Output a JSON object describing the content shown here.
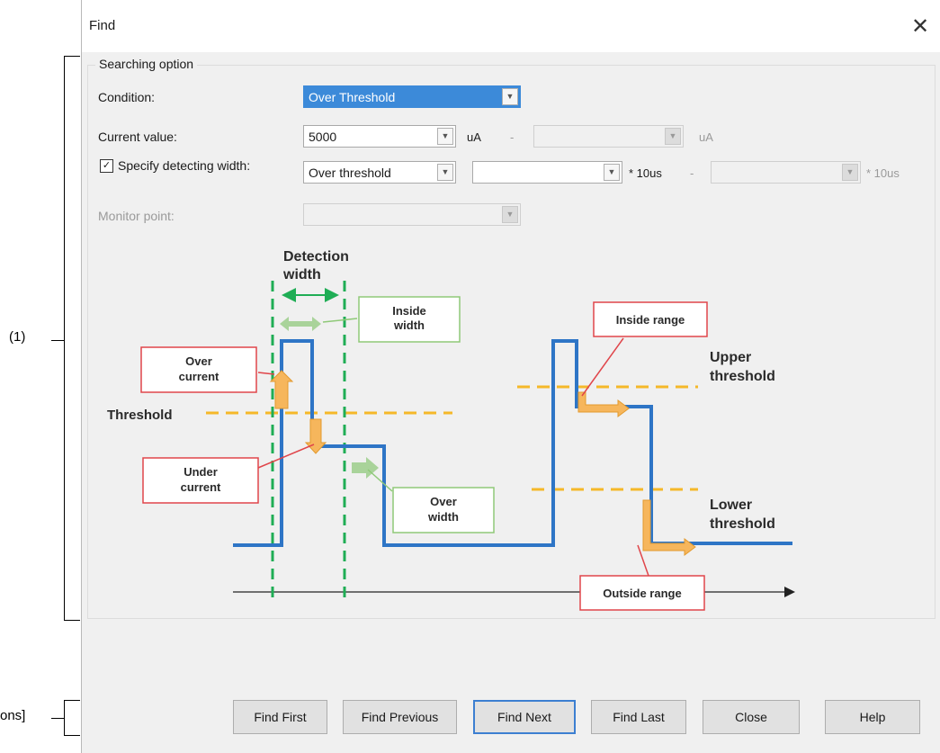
{
  "annotations": {
    "bracket1": "(1)",
    "bracket2": "ons]"
  },
  "dialog": {
    "title": "Find",
    "close_glyph": "✕"
  },
  "searching_option": {
    "group_title": "Searching option",
    "condition": {
      "label": "Condition:",
      "value": "Over Threshold"
    },
    "current_value": {
      "label": "Current value:",
      "value": "5000",
      "unit": "uA",
      "separator": "-",
      "upper_value": "",
      "upper_unit": "uA"
    },
    "detecting_width": {
      "checked": true,
      "check_glyph": "✓",
      "label": "Specify detecting width:",
      "mode": "Over threshold",
      "value": "",
      "unit": "* 10us",
      "separator": "-",
      "upper_value": "",
      "upper_unit": "* 10us"
    },
    "monitor_point": {
      "label": "Monitor point:",
      "value": ""
    }
  },
  "diagram": {
    "detection_width_line1": "Detection",
    "detection_width_line2": "width",
    "inside_width_line1": "Inside",
    "inside_width_line2": "width",
    "over_current_line1": "Over",
    "over_current_line2": "current",
    "threshold": "Threshold",
    "under_current_line1": "Under",
    "under_current_line2": "current",
    "over_width_line1": "Over",
    "over_width_line2": "width",
    "inside_range": "Inside range",
    "upper_threshold_line1": "Upper",
    "upper_threshold_line2": "threshold",
    "lower_threshold_line1": "Lower",
    "lower_threshold_line2": "threshold",
    "outside_range": "Outside range",
    "colors": {
      "signal": "#2e75c6",
      "threshold": "#f5b829",
      "detection": "#1fad55",
      "callout_red": "#e0454a",
      "callout_green": "#8fc978",
      "arrow_orange": "#f6b65c"
    }
  },
  "buttons": {
    "find_first": "Find First",
    "find_previous": "Find Previous",
    "find_next": "Find Next",
    "find_last": "Find Last",
    "close": "Close",
    "help": "Help"
  }
}
